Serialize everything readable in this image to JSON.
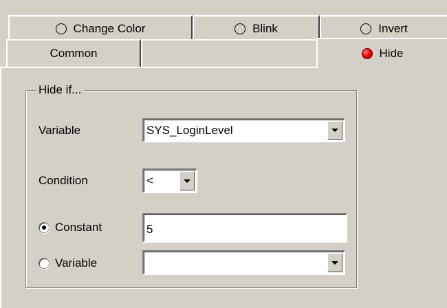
{
  "tabs_row1": [
    {
      "label": "Change Color",
      "active": false
    },
    {
      "label": "Blink",
      "active": false
    },
    {
      "label": "Invert",
      "active": false
    }
  ],
  "tabs_row2": [
    {
      "label": "Common"
    },
    {
      "label": ""
    },
    {
      "label": "Hide",
      "status": "active-red"
    }
  ],
  "group": {
    "title": "Hide if...",
    "variable_label": "Variable",
    "variable_value": "SYS_LoginLevel",
    "condition_label": "Condition",
    "condition_value": "<",
    "constant_label": "Constant",
    "constant_value": "5",
    "constant_selected": true,
    "variable_option_label": "Variable",
    "variable_option_value": "",
    "variable_option_selected": false
  },
  "colors": {
    "background": "#d4d0c8",
    "hide_indicator": "#f00000"
  }
}
